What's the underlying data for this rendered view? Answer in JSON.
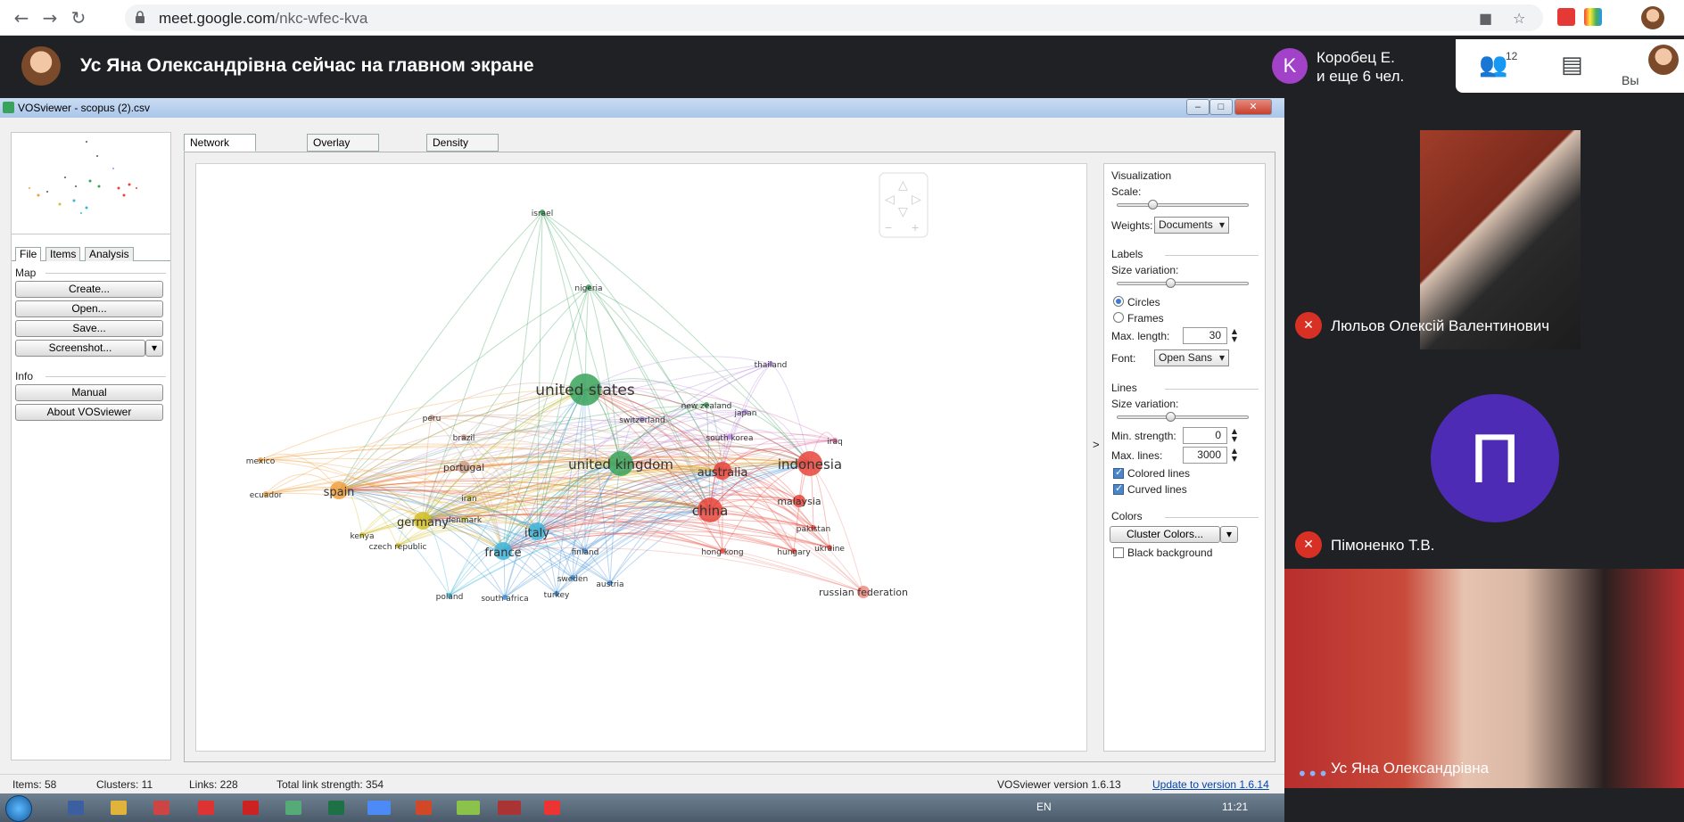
{
  "browser": {
    "url_host": "meet.google.com",
    "url_path": "/nkc-wfec-kva",
    "back_icon": "arrow-left-icon",
    "forward_icon": "arrow-right-icon",
    "reload_icon": "reload-icon"
  },
  "meet": {
    "presenter_text": "Ус Яна Олександрівна сейчас на главном экране",
    "chip_initial": "K",
    "chip_line1": "Коробец Е.",
    "chip_line2": "и еще 6 чел.",
    "participants_count": "12",
    "you_label": "Вы",
    "accent": "#a142c8"
  },
  "vosviewer": {
    "window_title": "VOSviewer - scopus (2).csv",
    "left_tabs": [
      "File",
      "Items",
      "Analysis"
    ],
    "map_section": "Map",
    "buttons_map": [
      "Create...",
      "Open...",
      "Save...",
      "Screenshot..."
    ],
    "info_section": "Info",
    "buttons_info": [
      "Manual",
      "About VOSviewer"
    ],
    "main_tabs": [
      "Network Visualization",
      "Overlay Visualization",
      "Density Visualization"
    ],
    "panel": {
      "visualization": "Visualization",
      "scale": "Scale:",
      "weights_label": "Weights:",
      "weights_value": "Documents",
      "labels": "Labels",
      "size_variation": "Size variation:",
      "circles": "Circles",
      "frames": "Frames",
      "max_length_label": "Max. length:",
      "max_length_value": "30",
      "font_label": "Font:",
      "font_value": "Open Sans",
      "lines": "Lines",
      "lines_size_variation": "Size variation:",
      "min_strength_label": "Min. strength:",
      "min_strength_value": "0",
      "max_lines_label": "Max. lines:",
      "max_lines_value": "3000",
      "colored_lines": "Colored lines",
      "curved_lines": "Curved lines",
      "colors": "Colors",
      "cluster_colors": "Cluster Colors...",
      "black_background": "Black background"
    },
    "status": {
      "items": "Items:  58",
      "clusters": "Clusters:  11",
      "links": "Links:  228",
      "total_link_strength": "Total link strength:  354",
      "version": "VOSviewer version 1.6.13",
      "update": "Update to version 1.6.14"
    },
    "network_nodes": [
      {
        "label": "israel",
        "color": "#3aa35b",
        "size": 1
      },
      {
        "label": "nigeria",
        "color": "#3aa35b",
        "size": 1
      },
      {
        "label": "united states",
        "color": "#3aa35b",
        "size": 5
      },
      {
        "label": "switzerland",
        "color": "#9b8fd6",
        "size": 1
      },
      {
        "label": "thailand",
        "color": "#b48be0",
        "size": 1
      },
      {
        "label": "new zealand",
        "color": "#3aa35b",
        "size": 1
      },
      {
        "label": "japan",
        "color": "#b48be0",
        "size": 1
      },
      {
        "label": "peru",
        "color": "#c89b8a",
        "size": 1
      },
      {
        "label": "brazil",
        "color": "#c89b8a",
        "size": 1
      },
      {
        "label": "south korea",
        "color": "#b48be0",
        "size": 1
      },
      {
        "label": "iraq",
        "color": "#e06a9b",
        "size": 1
      },
      {
        "label": "mexico",
        "color": "#f0a040",
        "size": 1
      },
      {
        "label": "portugal",
        "color": "#c89b8a",
        "size": 2
      },
      {
        "label": "united kingdom",
        "color": "#3aa35b",
        "size": 4
      },
      {
        "label": "australia",
        "color": "#e8443a",
        "size": 3
      },
      {
        "label": "indonesia",
        "color": "#e8443a",
        "size": 4
      },
      {
        "label": "ecuador",
        "color": "#f0a040",
        "size": 1
      },
      {
        "label": "spain",
        "color": "#f0a040",
        "size": 3
      },
      {
        "label": "iran",
        "color": "#d4c12a",
        "size": 1
      },
      {
        "label": "malaysia",
        "color": "#e8443a",
        "size": 2
      },
      {
        "label": "china",
        "color": "#e8443a",
        "size": 4
      },
      {
        "label": "germany",
        "color": "#d4c12a",
        "size": 3
      },
      {
        "label": "denmark",
        "color": "#d4c12a",
        "size": 1
      },
      {
        "label": "italy",
        "color": "#3fb4d8",
        "size": 3
      },
      {
        "label": "pakistan",
        "color": "#e8443a",
        "size": 1
      },
      {
        "label": "kenya",
        "color": "#d4c12a",
        "size": 1
      },
      {
        "label": "czech republic",
        "color": "#d4c12a",
        "size": 1
      },
      {
        "label": "france",
        "color": "#3fb4d8",
        "size": 3
      },
      {
        "label": "finland",
        "color": "#3f8fd8",
        "size": 1
      },
      {
        "label": "hong kong",
        "color": "#e8443a",
        "size": 1
      },
      {
        "label": "hungary",
        "color": "#e8443a",
        "size": 1
      },
      {
        "label": "ukraine",
        "color": "#e8443a",
        "size": 1
      },
      {
        "label": "sweden",
        "color": "#3f8fd8",
        "size": 1
      },
      {
        "label": "austria",
        "color": "#3f8fd8",
        "size": 1
      },
      {
        "label": "poland",
        "color": "#3fb4d8",
        "size": 1
      },
      {
        "label": "turkey",
        "color": "#3f8fd8",
        "size": 1
      },
      {
        "label": "south africa",
        "color": "#3f8fd8",
        "size": 1
      },
      {
        "label": "russian federation",
        "color": "#ef8a80",
        "size": 2
      }
    ]
  },
  "taskbar": {
    "lang": "EN",
    "time": "11:21"
  },
  "tiles": [
    {
      "name": "Люльов Олексій Валентинович",
      "muted": true
    },
    {
      "name": "Пімоненко Т.В.",
      "muted": true,
      "initial": "П",
      "avatar_color": "#4e2bb5"
    },
    {
      "name": "Ус Яна Олександрівна",
      "muted": false
    }
  ]
}
